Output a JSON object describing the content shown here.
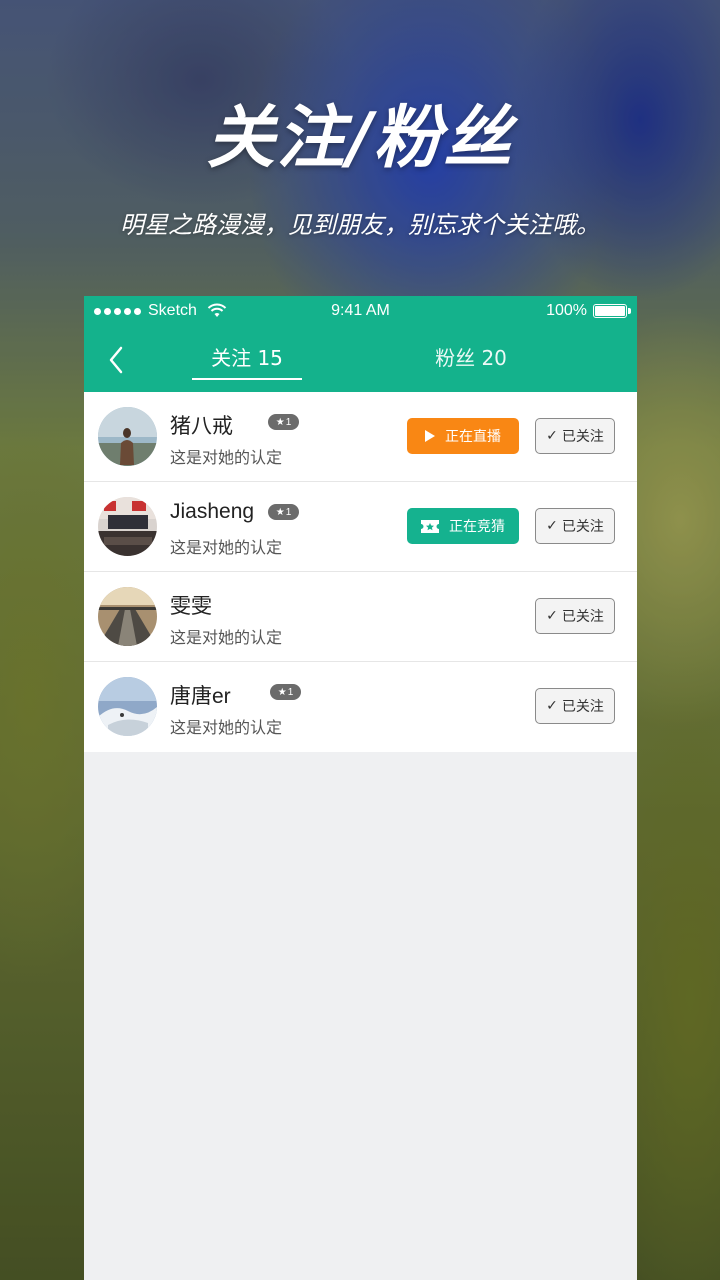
{
  "hero": {
    "title": "关注/粉丝",
    "subtitle": "明星之路漫漫，见到朋友，别忘求个关注哦。"
  },
  "status_bar": {
    "carrier": "Sketch",
    "time": "9:41 AM",
    "battery": "100%"
  },
  "tabs": {
    "follow": "关注 15",
    "fans": "粉丝 20",
    "active": "follow"
  },
  "colors": {
    "brand": "#14b28c",
    "live": "#f98714",
    "guess": "#15b28f"
  },
  "users": [
    {
      "name": "猪八戒",
      "level": "1",
      "subtitle": "这是对她的认定",
      "status": "正在直播",
      "status_type": "live",
      "follow_label": "已关注"
    },
    {
      "name": "Jiasheng",
      "level": "1",
      "subtitle": "这是对她的认定",
      "status": "正在竞猜",
      "status_type": "guess",
      "follow_label": "已关注"
    },
    {
      "name": "雯雯",
      "subtitle": "这是对她的认定",
      "follow_label": "已关注"
    },
    {
      "name": "唐唐er",
      "level": "1",
      "subtitle": "这是对她的认定",
      "follow_label": "已关注"
    }
  ]
}
